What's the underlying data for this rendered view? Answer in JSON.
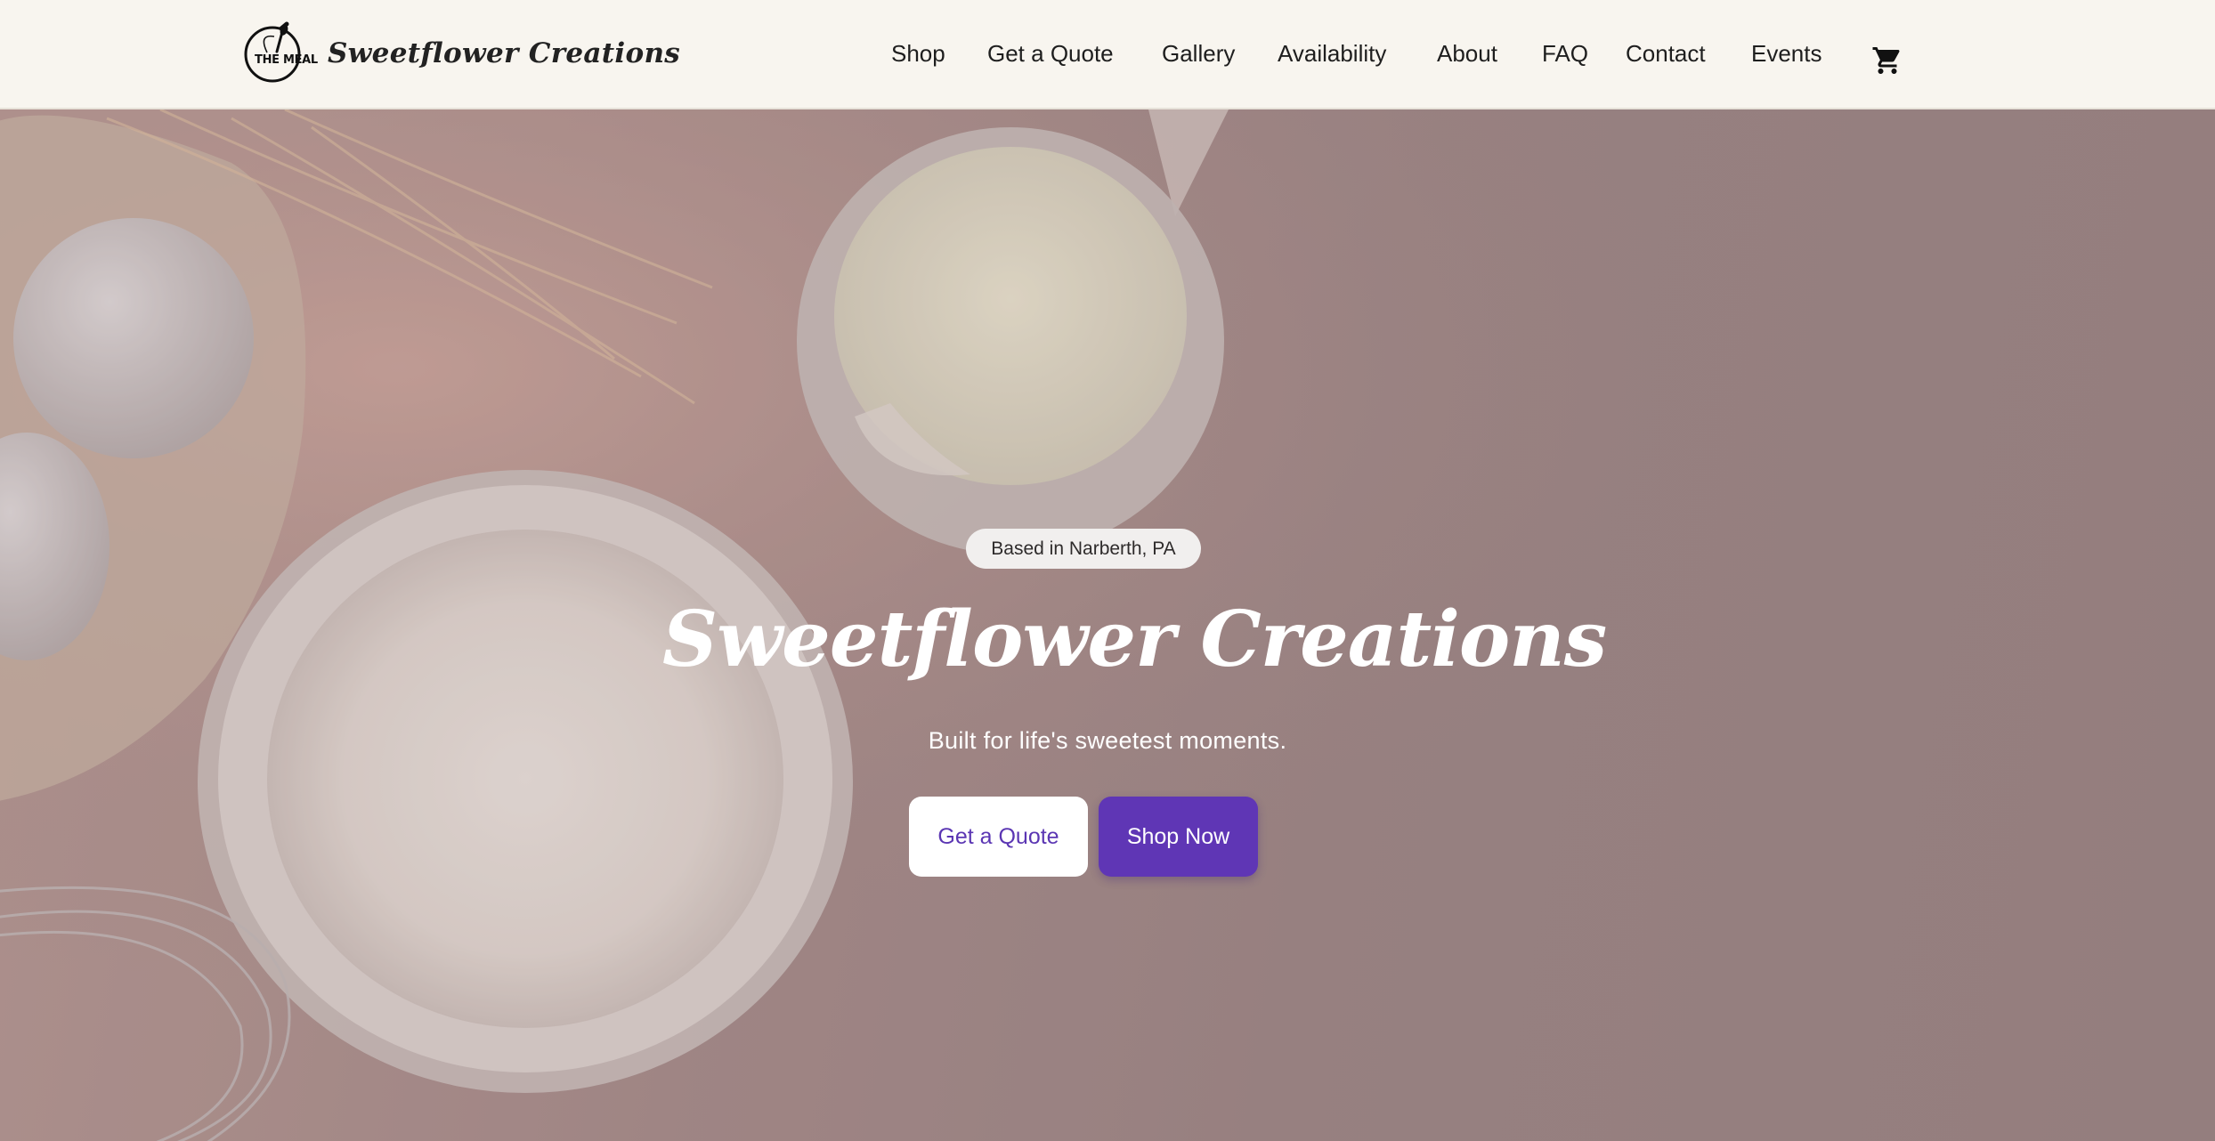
{
  "header": {
    "logo_mark_text": "THE MEAL",
    "brand_name": "Sweetflower Creations",
    "logo_icon": "whisk-spoon-icon",
    "nav": [
      {
        "label": "Shop"
      },
      {
        "label": "Get a Quote"
      },
      {
        "label": "Gallery"
      },
      {
        "label": "Availability"
      },
      {
        "label": "About"
      },
      {
        "label": "FAQ"
      },
      {
        "label": "Contact"
      },
      {
        "label": "Events"
      }
    ],
    "cart_icon": "cart-icon"
  },
  "hero": {
    "location": "Based in Narberth, PA",
    "title": "Sweetflower Creations",
    "subtitle": "Built for life's sweetest moments.",
    "primary_button": "Get a Quote",
    "secondary_button": "Shop Now"
  },
  "colors": {
    "header_bg": "#f8f5ef",
    "accent": "#5f36b5",
    "hero_tint": "#9e8888"
  }
}
